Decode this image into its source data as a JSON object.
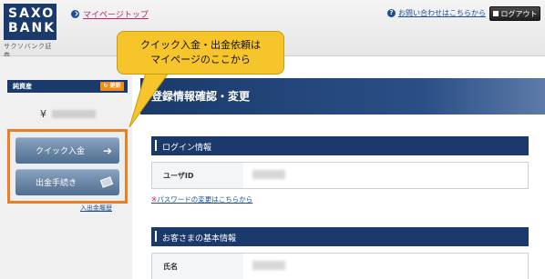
{
  "header": {
    "logo_line1": "SAXO",
    "logo_line2": "BANK",
    "logo_sub": "サクソバンク証券",
    "mypage_link": "マイページトップ",
    "contact_link": "お問い合わせはこちらから",
    "logout_label": "ログアウト"
  },
  "sidebar": {
    "net_assets_label": "純資産",
    "update_label": "更新",
    "currency_symbol": "¥",
    "quick_deposit_label": "クイック入金",
    "withdraw_label": "出金手続き",
    "history_link": "入出金履歴"
  },
  "main": {
    "title": "登録情報確認・変更",
    "login_section": "ログイン情報",
    "user_id_label": "ユーザID",
    "pw_note_mark": "※",
    "pw_link": "パスワードの変更はこちらから",
    "customer_section": "お客さまの基本情報",
    "name_label": "氏名"
  },
  "callout": {
    "line1": "クイック入金・出金依頼は",
    "line2": "マイページのここから"
  },
  "colors": {
    "navy": "#1b3a6b",
    "accent_orange": "#ef7d1b",
    "callout_yellow": "#f6c52b",
    "link_magenta": "#c0246a"
  }
}
